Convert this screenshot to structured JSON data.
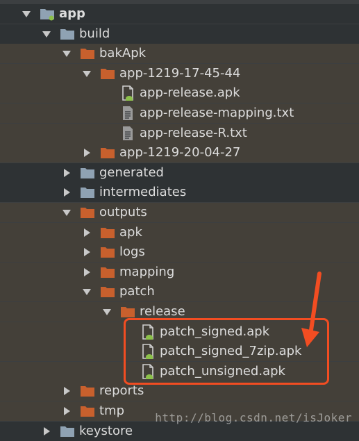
{
  "tree": [
    {
      "label": "app",
      "icon": "module-folder-icon",
      "arrow": "expanded",
      "bold": true
    },
    {
      "label": "build",
      "icon": "folder-icon",
      "arrow": "expanded"
    },
    {
      "label": "bakApk",
      "icon": "excluded-folder-icon",
      "arrow": "expanded"
    },
    {
      "label": "app-1219-17-45-44",
      "icon": "excluded-folder-icon",
      "arrow": "expanded"
    },
    {
      "label": "app-release.apk",
      "icon": "android-file-icon",
      "arrow": "none"
    },
    {
      "label": "app-release-mapping.txt",
      "icon": "text-file-icon",
      "arrow": "none"
    },
    {
      "label": "app-release-R.txt",
      "icon": "text-file-icon",
      "arrow": "none"
    },
    {
      "label": "app-1219-20-04-27",
      "icon": "excluded-folder-icon",
      "arrow": "collapsed"
    },
    {
      "label": "generated",
      "icon": "folder-icon",
      "arrow": "collapsed"
    },
    {
      "label": "intermediates",
      "icon": "folder-icon",
      "arrow": "collapsed"
    },
    {
      "label": "outputs",
      "icon": "excluded-folder-icon",
      "arrow": "expanded"
    },
    {
      "label": "apk",
      "icon": "excluded-folder-icon",
      "arrow": "collapsed"
    },
    {
      "label": "logs",
      "icon": "excluded-folder-icon",
      "arrow": "collapsed"
    },
    {
      "label": "mapping",
      "icon": "excluded-folder-icon",
      "arrow": "collapsed"
    },
    {
      "label": "patch",
      "icon": "excluded-folder-icon",
      "arrow": "expanded"
    },
    {
      "label": "release",
      "icon": "excluded-folder-icon",
      "arrow": "expanded"
    },
    {
      "label": "patch_signed.apk",
      "icon": "android-file-icon",
      "arrow": "none"
    },
    {
      "label": "patch_signed_7zip.apk",
      "icon": "android-file-icon",
      "arrow": "none"
    },
    {
      "label": "patch_unsigned.apk",
      "icon": "android-file-icon",
      "arrow": "none"
    },
    {
      "label": "reports",
      "icon": "excluded-folder-icon",
      "arrow": "collapsed"
    },
    {
      "label": "tmp",
      "icon": "excluded-folder-icon",
      "arrow": "collapsed"
    },
    {
      "label": "keystore",
      "icon": "folder-icon",
      "arrow": "collapsed"
    }
  ],
  "colors": {
    "background": "#3c3f41",
    "row_dark": "#2e3234",
    "row_olive": "#444039",
    "text": "#dcdcdc",
    "folder_blue": "#8fa2b3",
    "folder_orange": "#c8602e",
    "android_green": "#8cc04a",
    "highlight": "#f24d22"
  },
  "watermark": "http://blog.csdn.net/isJoker"
}
